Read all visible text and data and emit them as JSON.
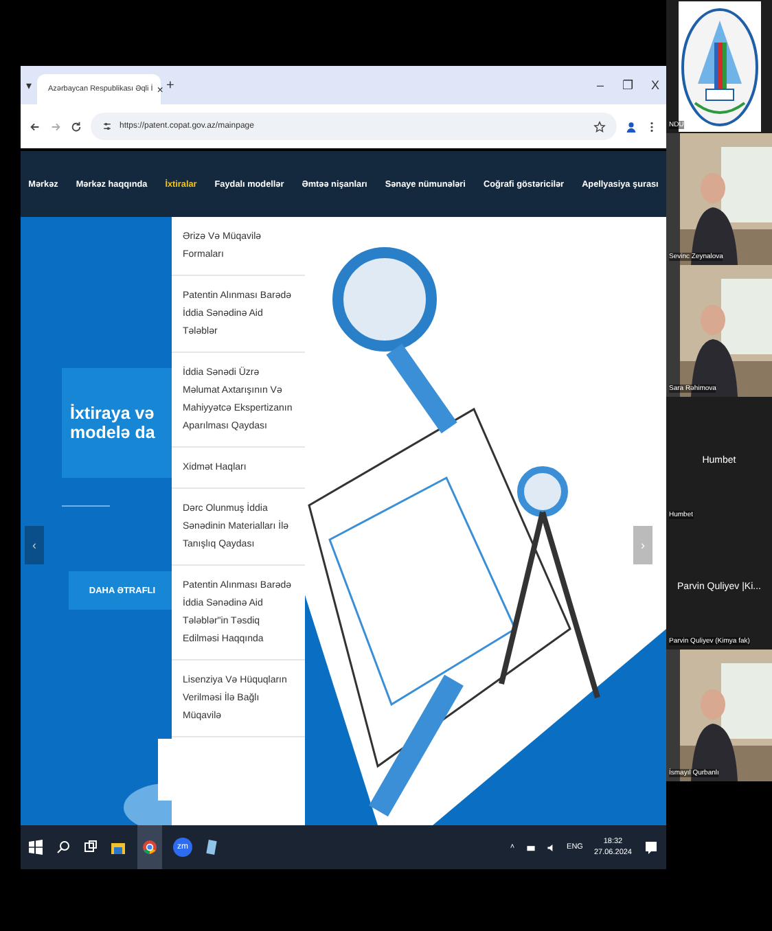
{
  "browser": {
    "tab_list": "▾",
    "tab_title": "Azərbaycan Respublikası Əqli İ",
    "tab_close": "×",
    "new_tab": "+",
    "window_controls": [
      "–",
      "❐",
      "X"
    ],
    "url": "https://patent.copat.gov.az/mainpage"
  },
  "nav": [
    {
      "label": "Mərkəz",
      "selected": false
    },
    {
      "label": "Mərkəz haqqında",
      "selected": false
    },
    {
      "label": "İxtiralar",
      "selected": true
    },
    {
      "label": "Faydalı modellər",
      "selected": false
    },
    {
      "label": "Əmtəə nişanları",
      "selected": false
    },
    {
      "label": "Sənaye nümunələri",
      "selected": false
    },
    {
      "label": "Coğrafi göstəricilər",
      "selected": false
    },
    {
      "label": "Apellyasiya şurası",
      "selected": false
    }
  ],
  "dropdown": [
    "Ərizə Və Müqavilə Formaları",
    "Patentin Alınması Barədə İddia Sənədinə Aid Tələblər",
    "İddia Sənədi Üzrə Məlumat Axtarışının Və Mahiyyətcə Ekspertizanın Aparılması Qaydası",
    "Xidmət Haqları",
    "Dərc Olunmuş İddia Sənədinin Materialları İlə Tanışlıq Qaydası",
    "Patentin Alınması Barədə İddia Sənədinə Aid Tələblər\"in Təsdiq Edilməsi Haqqında",
    "Lisenziya Və Hüquqların Verilməsi İlə Bağlı Müqavilə"
  ],
  "hero": {
    "heading_lines": [
      "İxtiraya və",
      "modelə da"
    ],
    "button": "DAHA ƏTRAFLI",
    "prev": "‹",
    "next": "›"
  },
  "taskbar": {
    "zoom_label": "zm",
    "tray_arrow": "˄",
    "language": "ENG",
    "time": "18:32",
    "date": "27.06.2024"
  },
  "participants": [
    {
      "kind": "logo",
      "label": "NDU"
    },
    {
      "kind": "video",
      "label": "Sevinc Zeynalova"
    },
    {
      "kind": "video",
      "label": "Sara Rəhimova"
    },
    {
      "kind": "name",
      "display": "Humbet",
      "label": "Humbet"
    },
    {
      "kind": "name",
      "display": "Parvin Quliyev |Ki...",
      "label": "Parvin Quliyev (Kimya fak)"
    },
    {
      "kind": "video",
      "label": "İsmayıl Qurbanlı"
    }
  ]
}
